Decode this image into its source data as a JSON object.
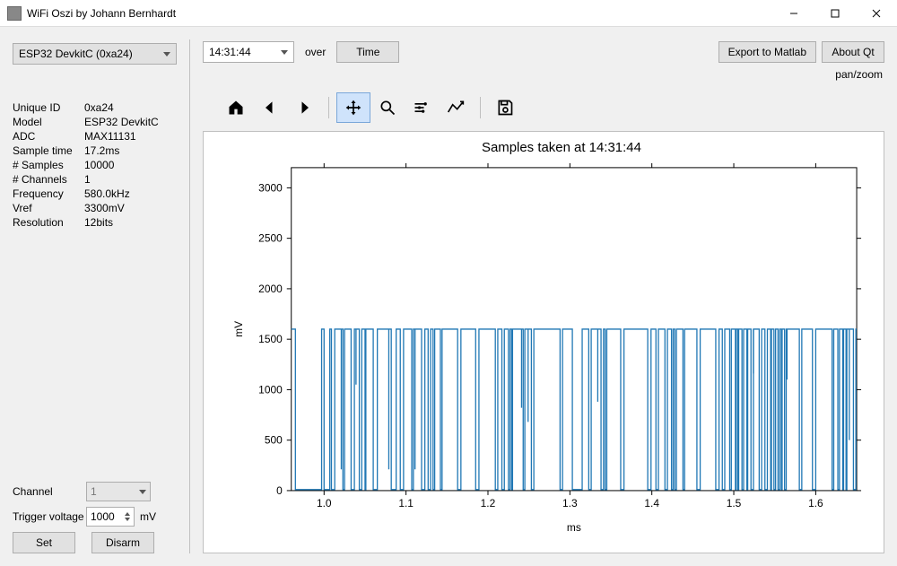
{
  "window": {
    "title": "WiFi Oszi by Johann Bernhardt"
  },
  "sidebar": {
    "device_select": "ESP32 DevkitC (0xa24)",
    "info": [
      {
        "k": "Unique ID",
        "v": "0xa24"
      },
      {
        "k": "Model",
        "v": "ESP32 DevkitC"
      },
      {
        "k": "ADC",
        "v": "MAX11131"
      },
      {
        "k": "Sample time",
        "v": "17.2ms"
      },
      {
        "k": "# Samples",
        "v": "10000"
      },
      {
        "k": "# Channels",
        "v": "1"
      },
      {
        "k": "Frequency",
        "v": "580.0kHz"
      },
      {
        "k": "Vref",
        "v": "3300mV"
      },
      {
        "k": "Resolution",
        "v": "12bits"
      }
    ],
    "channel_label": "Channel",
    "channel_value": "1",
    "trigger_label": "Trigger voltage",
    "trigger_value": "1000",
    "trigger_unit": "mV",
    "set_label": "Set",
    "disarm_label": "Disarm"
  },
  "topbar": {
    "time_value": "14:31:44",
    "over": "over",
    "xaxis_btn": "Time",
    "export_btn": "Export to Matlab",
    "about_btn": "About Qt"
  },
  "status": {
    "mode": "pan/zoom"
  },
  "chart_data": {
    "type": "line",
    "title": "Samples taken at 14:31:44",
    "xlabel": "ms",
    "ylabel": "mV",
    "xlim": [
      0.96,
      1.65
    ],
    "ylim": [
      0,
      3200
    ],
    "xticks": [
      1.0,
      1.1,
      1.2,
      1.3,
      1.4,
      1.5,
      1.6
    ],
    "yticks": [
      0,
      500,
      1000,
      1500,
      2000,
      2500,
      3000
    ],
    "signal_high": 1600,
    "signal_low": 10,
    "transitions": [
      0.965,
      0.997,
      1.0,
      1.007,
      1.009,
      1.013,
      1.023,
      1.025,
      1.033,
      1.037,
      1.043,
      1.046,
      1.05,
      1.051,
      1.06,
      1.065,
      1.082,
      1.088,
      1.093,
      1.097,
      1.107,
      1.109,
      1.119,
      1.123,
      1.127,
      1.13,
      1.133,
      1.135,
      1.142,
      1.144,
      1.163,
      1.167,
      1.185,
      1.189,
      1.209,
      1.212,
      1.217,
      1.22,
      1.225,
      1.227,
      1.229,
      1.23,
      1.243,
      1.245,
      1.253,
      1.256,
      1.288,
      1.291,
      1.303,
      1.315,
      1.323,
      1.326,
      1.338,
      1.341,
      1.343,
      1.345,
      1.362,
      1.366,
      1.395,
      1.399,
      1.405,
      1.408,
      1.416,
      1.419,
      1.424,
      1.426,
      1.428,
      1.43,
      1.438,
      1.44,
      1.455,
      1.459,
      1.478,
      1.482,
      1.486,
      1.489,
      1.495,
      1.497,
      1.502,
      1.503,
      1.505,
      1.506,
      1.51,
      1.512,
      1.516,
      1.517,
      1.521,
      1.524,
      1.531,
      1.534,
      1.538,
      1.541,
      1.545,
      1.546,
      1.549,
      1.551,
      1.554,
      1.556,
      1.558,
      1.559,
      1.562,
      1.564,
      1.58,
      1.583,
      1.596,
      1.6,
      1.62,
      1.622,
      1.627,
      1.629,
      1.633,
      1.634,
      1.637,
      1.638,
      1.646,
      1.649
    ],
    "mid_spikes": [
      {
        "x": 1.021,
        "y": 210
      },
      {
        "x": 1.039,
        "y": 1050
      },
      {
        "x": 1.079,
        "y": 210
      },
      {
        "x": 1.111,
        "y": 210
      },
      {
        "x": 1.241,
        "y": 820
      },
      {
        "x": 1.249,
        "y": 680
      },
      {
        "x": 1.334,
        "y": 880
      },
      {
        "x": 1.524,
        "y": 1160
      },
      {
        "x": 1.565,
        "y": 1100
      },
      {
        "x": 1.641,
        "y": 500
      }
    ]
  }
}
